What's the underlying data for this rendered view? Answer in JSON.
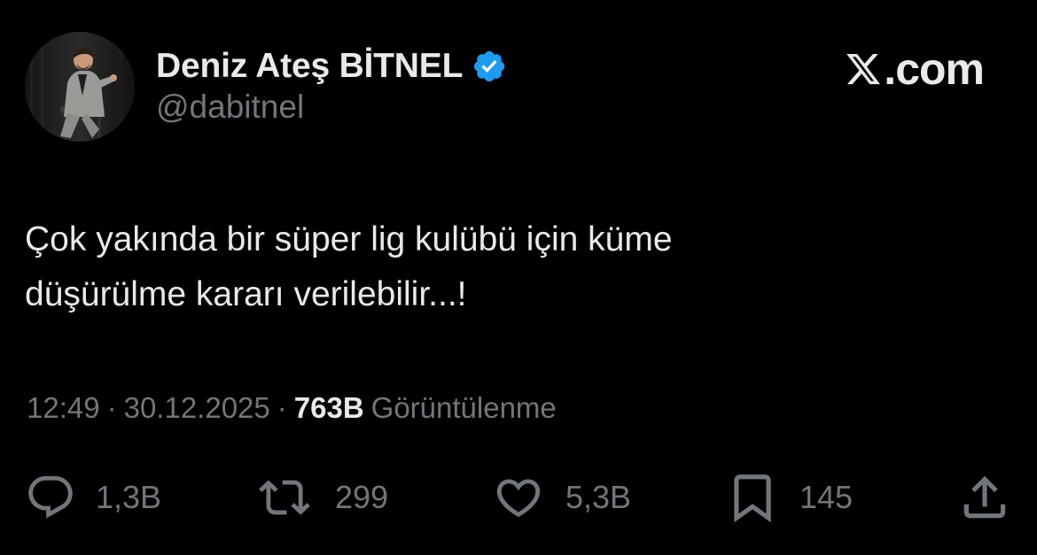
{
  "author": {
    "display_name": "Deniz Ateş BİTNEL",
    "handle": "@dabitnel",
    "verified": true
  },
  "brand": {
    "label": ".com",
    "icon": "x-logo-icon"
  },
  "tweet": {
    "lines": [
      "Çok yakında bir süper lig kulübü için küme",
      "düşürülme kararı verilebilir...!"
    ]
  },
  "meta": {
    "time": "12:49",
    "separator": "·",
    "date": "30.12.2025",
    "views_count": "763B",
    "views_label": "Görüntülenme"
  },
  "actions": {
    "replies": "1,3B",
    "reposts": "299",
    "likes": "5,3B",
    "bookmarks": "145"
  },
  "colors": {
    "background": "#000000",
    "primary_text": "#e7e9ea",
    "secondary_text": "#71767b",
    "verified_badge": "#1d9bf0"
  }
}
